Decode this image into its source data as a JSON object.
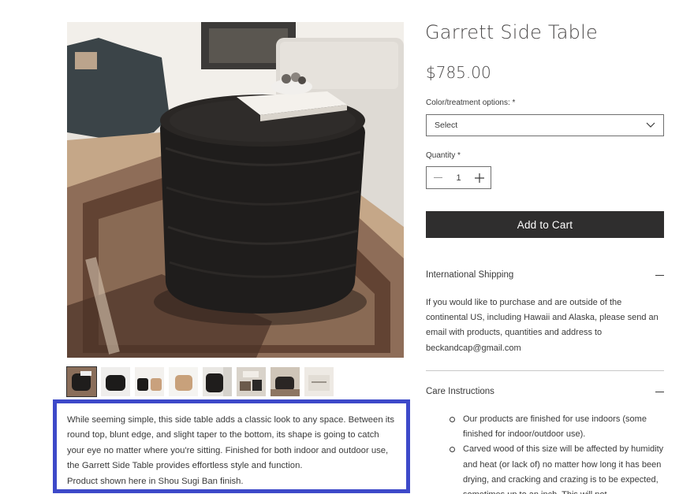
{
  "product": {
    "title": "Garrett Side Table",
    "price": "$785.00"
  },
  "options": {
    "color_label": "Color/treatment options: *",
    "color_selected": "Select",
    "quantity_label": "Quantity *",
    "quantity_value": "1"
  },
  "actions": {
    "add_to_cart": "Add to Cart"
  },
  "shipping": {
    "title": "International Shipping",
    "body": "If you would like to purchase and are outside of the continental US, including Hawaii and Alaska, please send an email with products, quantities and address to beckandcap@gmail.com"
  },
  "care": {
    "title": "Care Instructions",
    "items": [
      "Our products are finished for use indoors (some finished for indoor/outdoor use).",
      "Carved wood of this size will be affected by humidity and heat (or lack of) no matter how long it has been drying, and cracking and crazing is to be expected, sometimes up to an inch. This will not"
    ]
  },
  "description": {
    "text": "While seeming simple, this side table adds a classic look to any space. Between its round top, blunt edge, and slight taper to the bottom, its shape is going to catch your eye no matter where you're sitting. Finished for both indoor and outdoor use, the Garrett Side Table provides effortless style and function.",
    "note": "Product shown here in Shou Sugi Ban finish."
  },
  "gallery": {
    "thumbnail_count": 8,
    "active_index": 0
  },
  "colors": {
    "button_bg": "#2f2e2e",
    "highlight_border": "#3d49c9",
    "text": "#3a3a3a"
  }
}
